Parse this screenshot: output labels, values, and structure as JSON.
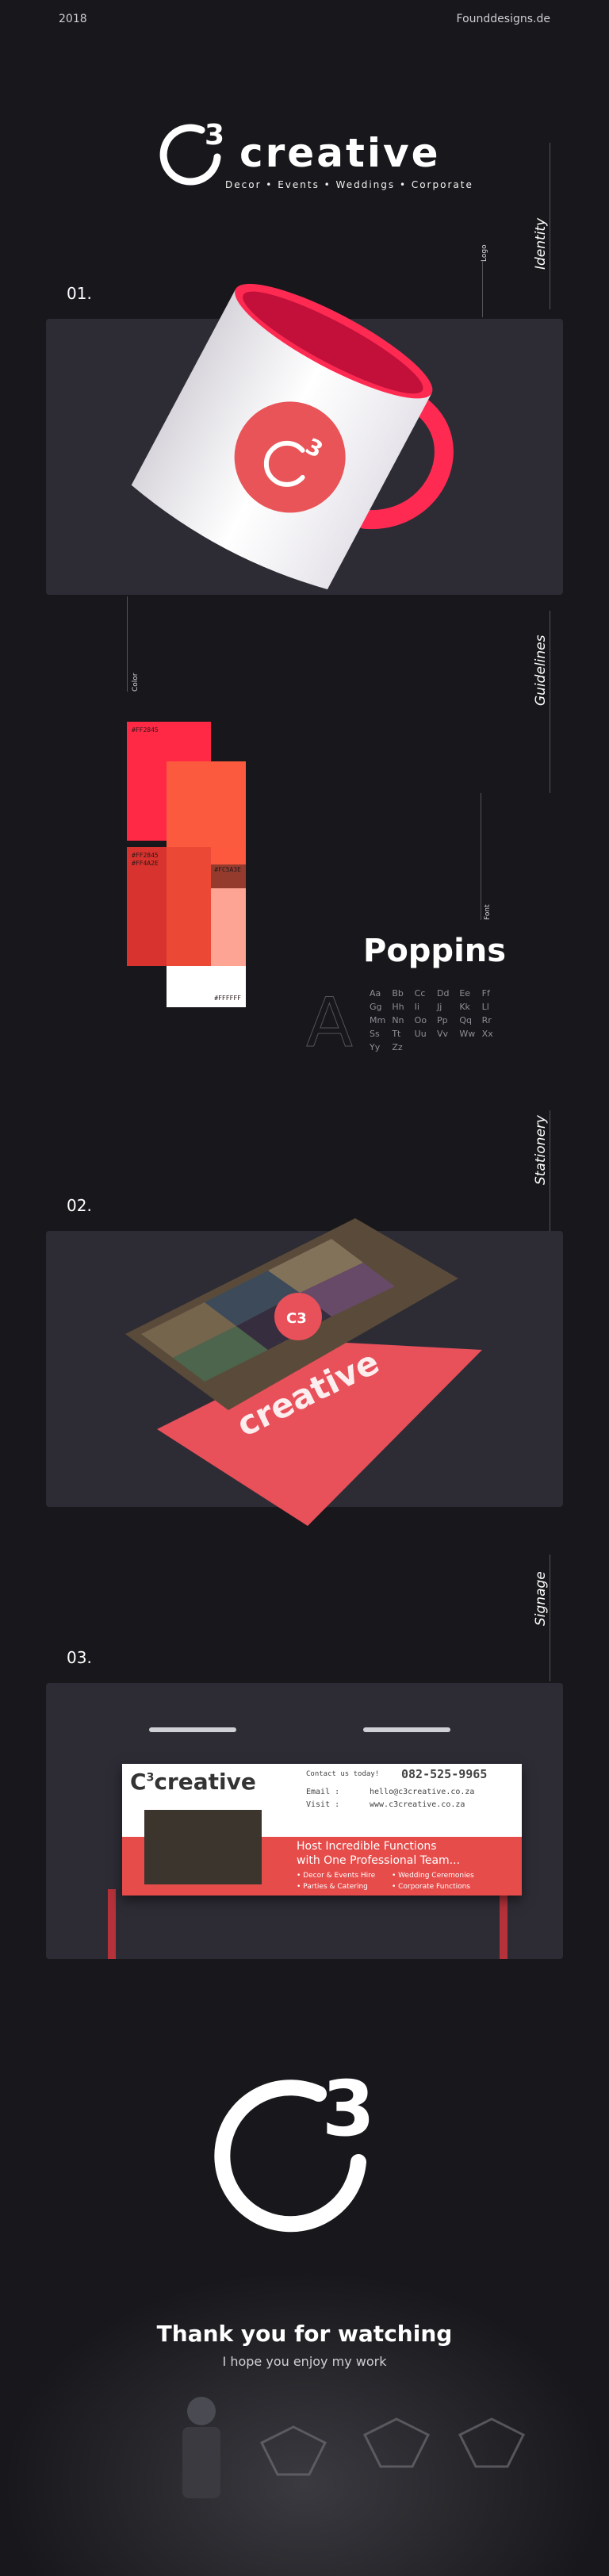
{
  "header": {
    "year": "2018",
    "site": "Founddesigns.de"
  },
  "brand": {
    "name": "creative",
    "tagline": "Decor • Events • Weddings • Corporate",
    "exponent": "3"
  },
  "sections": {
    "identity": "Identity",
    "guidelines": "Guidelines",
    "stationery": "Stationery",
    "signage": "Signage"
  },
  "sublabels": {
    "logo": "Logo",
    "color": "Color",
    "font": "Font"
  },
  "numbers": {
    "one": "01.",
    "two": "02.",
    "three": "03."
  },
  "swatches": [
    {
      "code": "#FF2845",
      "color": "#ff2845"
    },
    {
      "code": "#FF4A2E",
      "color": "#ff4a2e"
    },
    {
      "code": "#FF2845\n#FF4A2E",
      "color": "#d8332e"
    },
    {
      "code": "#FFFFFF",
      "color": "#ffffff"
    }
  ],
  "overlay_code": "#FC5A3E",
  "font": {
    "name": "Poppins",
    "alphabet": [
      "Aa",
      "Bb",
      "Cc",
      "Dd",
      "Ee",
      "Ff",
      "Gg",
      "Hh",
      "Ii",
      "Jj",
      "Kk",
      "Ll",
      "Mm",
      "Nn",
      "Oo",
      "Pp",
      "Qq",
      "Rr",
      "Ss",
      "Tt",
      "Uu",
      "Vv",
      "Ww",
      "Xx",
      "Yy",
      "Zz"
    ],
    "sample_letter": "A"
  },
  "sign": {
    "contact_heading": "Contact us today!",
    "phone": "082-525-9965",
    "email_label": "Email :",
    "email_value": "hello@c3creative.co.za",
    "visit_label": "Visit :",
    "visit_value": "www.c3creative.co.za",
    "headline_1": "Host Incredible Functions",
    "headline_2": "with One Professional Team...",
    "bullets": [
      "• Decor & Events Hire",
      "• Wedding Ceremonies",
      "• Parties & Catering",
      "• Corporate Functions"
    ]
  },
  "footer": {
    "thanks": "Thank you for watching",
    "sub": "I hope you enjoy my work"
  },
  "colors": {
    "accent": "#ff2845",
    "accent2": "#fc5a3e",
    "panel": "#2d2c35",
    "bg": "#18171b"
  }
}
